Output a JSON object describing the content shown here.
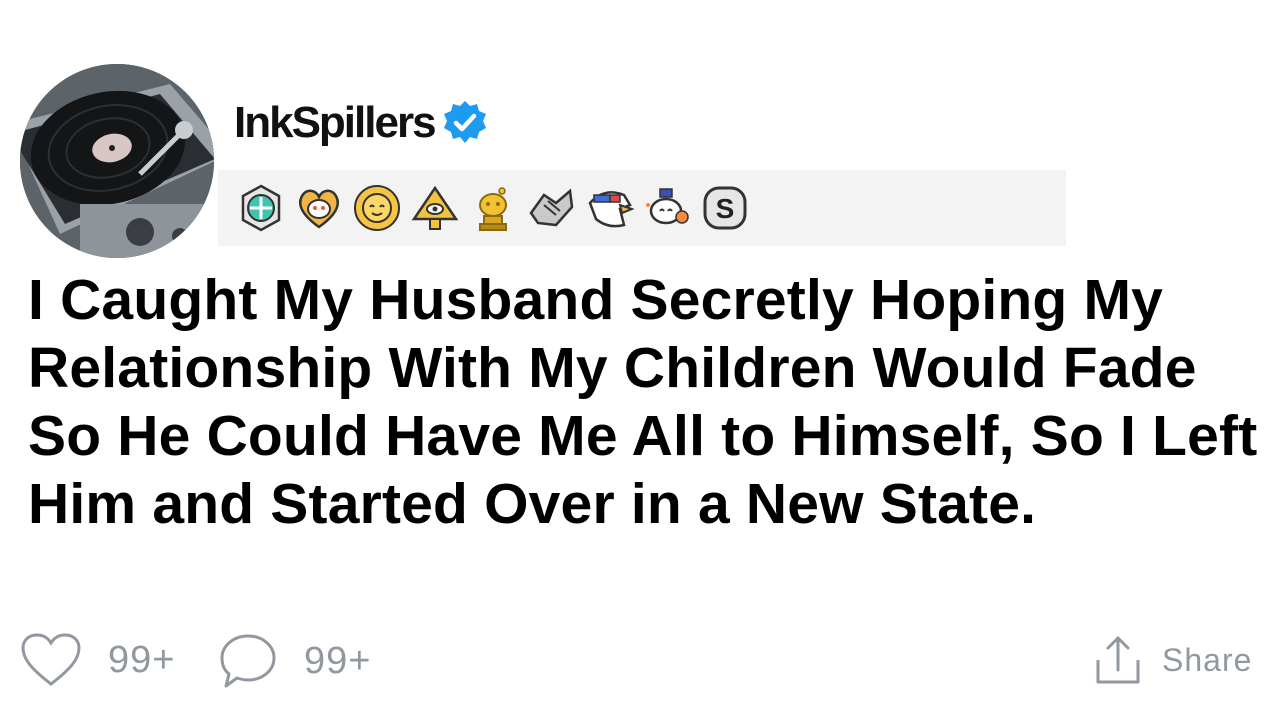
{
  "post": {
    "username": "InkSpillers",
    "verified": true,
    "title": "I Caught My Husband Secretly Hoping My Relationship With My Children Would Fade So He Could Have Me All to Himself, So I Left Him and Started Over in a New State."
  },
  "avatar": {
    "icon": "record-player-icon"
  },
  "awards": [
    {
      "icon": "gem-award-icon"
    },
    {
      "icon": "heart-snoo-award-icon"
    },
    {
      "icon": "sun-award-icon"
    },
    {
      "icon": "pyramid-eye-award-icon"
    },
    {
      "icon": "gold-snoo-trophy-award-icon"
    },
    {
      "icon": "handshake-award-icon"
    },
    {
      "icon": "eagle-award-icon"
    },
    {
      "icon": "snoo-party-award-icon"
    },
    {
      "icon": "silver-s-award-icon"
    }
  ],
  "actions": {
    "likes": "99+",
    "comments": "99+",
    "share_label": "Share"
  },
  "colors": {
    "text": "#000000",
    "muted": "#9298a0",
    "verified_blue": "#1d9bf0",
    "awards_bg": "#f3f3f3"
  }
}
